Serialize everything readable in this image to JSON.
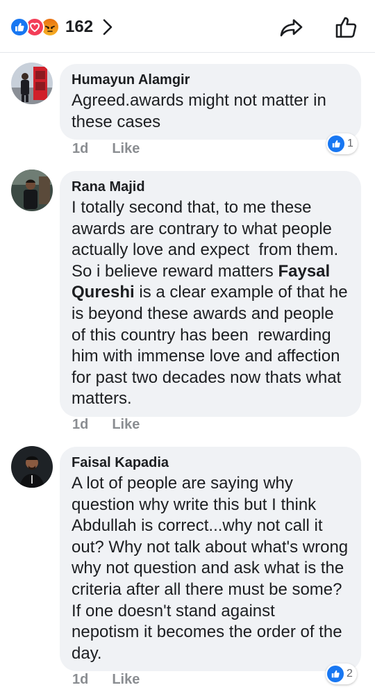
{
  "reactions": {
    "count": "162",
    "types": [
      "like-icon",
      "love-icon",
      "angry-icon"
    ],
    "colors": {
      "like": "#1877f2",
      "love": "#f33e58",
      "angry": "#f7b125"
    }
  },
  "comments": [
    {
      "author": "Humayun Alamgir",
      "lines": [
        "Agreed.awards might not matter in",
        "these cases"
      ],
      "time": "1d",
      "like_label": "Like",
      "reaction_count": "1"
    },
    {
      "author": "Rana Majid",
      "lines": [
        "I totally second that, to me these",
        "awards are contrary to what people",
        "actually love and expect  from them.",
        "So i believe reward matters ",
        "Faysal",
        "Qureshi",
        " is a clear example of that he",
        "is beyond these awards and people",
        "of this country has been  rewarding",
        "him with immense love and affection",
        "for past two decades now thats what",
        "matters."
      ],
      "time": "1d",
      "like_label": "Like"
    },
    {
      "author": "Faisal Kapadia",
      "lines": [
        "A lot of people are saying why",
        "question why write this but I think",
        "Abdullah is correct...why not call it",
        "out? Why not talk about what's wrong",
        "why not question and ask what is the",
        "criteria after all there must be some?",
        "If one doesn't stand against",
        "nepotism it becomes the order of the",
        "day."
      ],
      "time": "1d",
      "like_label": "Like",
      "reaction_count": "2"
    }
  ]
}
